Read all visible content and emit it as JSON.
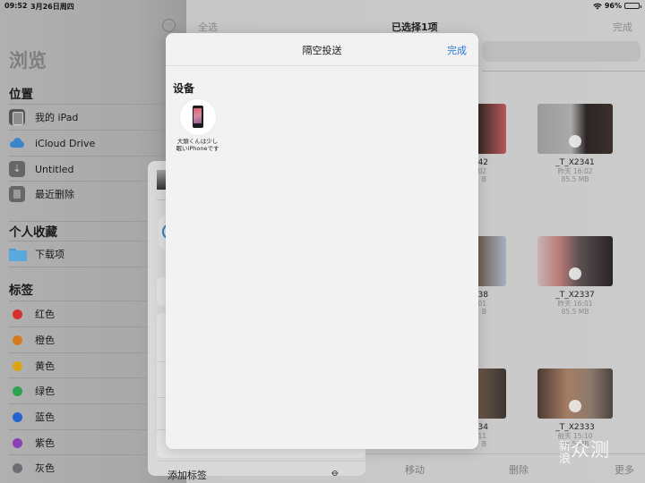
{
  "status_bar": {
    "time": "09:52",
    "date": "3月26日周四",
    "wifi_icon": "wifi-icon",
    "battery_percent": "96%",
    "battery_level": 0.96
  },
  "sidebar": {
    "more_icon": "ellipsis-circle-icon",
    "title": "浏览",
    "sections": [
      {
        "heading": "位置",
        "items": [
          {
            "label": "我的 iPad",
            "icon": "ipad-icon"
          },
          {
            "label": "iCloud Drive",
            "icon": "icloud-icon"
          },
          {
            "label": "Untitled",
            "icon": "usb-icon"
          },
          {
            "label": "最近删除",
            "icon": "trash-icon"
          }
        ]
      },
      {
        "heading": "个人收藏",
        "items": [
          {
            "label": "下载项",
            "icon": "folder-icon"
          }
        ]
      },
      {
        "heading": "标签",
        "items": [
          {
            "label": "红色",
            "color": "#d8302e"
          },
          {
            "label": "橙色",
            "color": "#d77a1e"
          },
          {
            "label": "黄色",
            "color": "#d9a417"
          },
          {
            "label": "绿色",
            "color": "#2ea24f"
          },
          {
            "label": "蓝色",
            "color": "#2364d0"
          },
          {
            "label": "紫色",
            "color": "#8b3fb4"
          },
          {
            "label": "灰色",
            "color": "#6d6d72"
          }
        ]
      }
    ]
  },
  "main": {
    "select_all": "全选",
    "title": "已选择1项",
    "done": "完成",
    "files": [
      {
        "name": "_T_X2341",
        "date": "昨天 16:02",
        "size": "85.5 MB"
      },
      {
        "name": "_T_X2337",
        "date": "昨天 16:01",
        "size": "85.5 MB"
      },
      {
        "name": "_T_X2333",
        "date": "前天 15:10",
        "size": "85.5 MB"
      }
    ],
    "partial_files": [
      {
        "name": "42",
        "date": "02",
        "size": "B"
      },
      {
        "name": "38",
        "date": "01",
        "size": "B"
      },
      {
        "name": "34",
        "date": "11",
        "size": "B"
      }
    ],
    "toolbar": {
      "move": "移动",
      "delete": "删除",
      "more": "更多"
    }
  },
  "share_sheet": {
    "add_tag": "添加标签",
    "tag_icon": "tag-icon",
    "airdrop_icon": "airdrop-icon"
  },
  "airdrop_modal": {
    "title": "隔空投送",
    "done": "完成",
    "devices_heading": "设备",
    "devices": [
      {
        "name_line1": "大頭くんは少し",
        "name_line2": "眠いiPhoneです",
        "icon": "iphone-icon"
      }
    ]
  },
  "watermark": {
    "text_small_1": "新",
    "text_small_2": "浪",
    "text_big": "众测"
  },
  "colors": {
    "accent_blue": "#2c7ad6"
  }
}
